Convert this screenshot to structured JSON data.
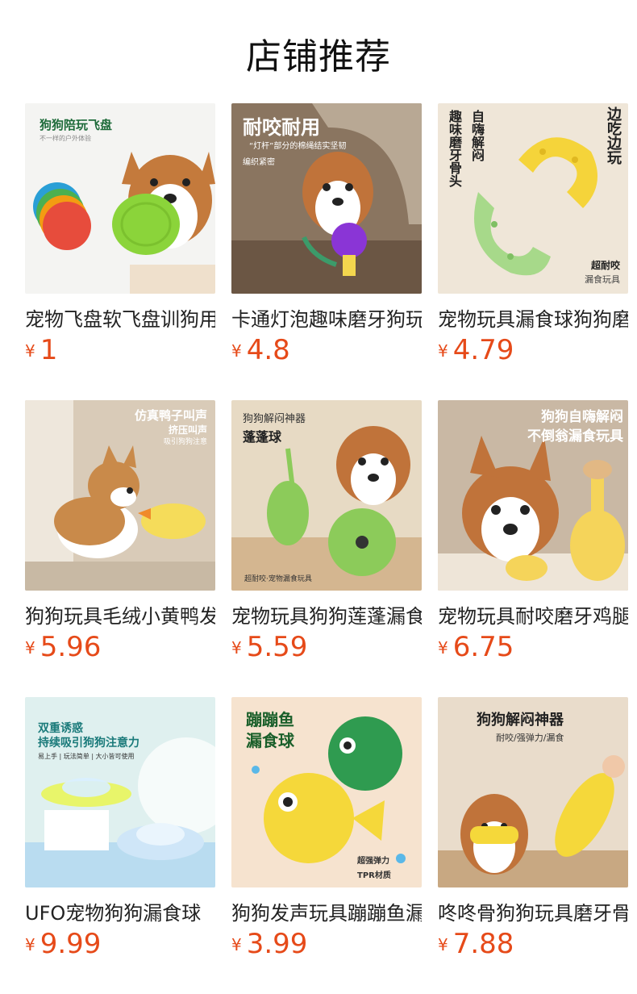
{
  "header": {
    "title": "店铺推荐"
  },
  "products": [
    {
      "name": "宠物飞盘软飞盘训狗用品",
      "currency": "¥",
      "price": "1",
      "image_text": [
        "狗狗陪玩飞盘",
        "不一样的户外体验"
      ],
      "bg": "#f4f4f2"
    },
    {
      "name": "卡通灯泡趣味磨牙狗玩具",
      "currency": "¥",
      "price": "4.8",
      "image_text": [
        "耐咬耐用",
        "“灯杆”部分的棉绳结实坚韧",
        "编织紧密"
      ],
      "bg": "#8a7560"
    },
    {
      "name": "宠物玩具漏食球狗狗磨牙",
      "currency": "¥",
      "price": "4.79",
      "image_text": [
        "趣味磨牙骨头",
        "自嗨解闷",
        "边吃边玩",
        "超耐咬",
        "漏食玩具"
      ],
      "bg": "#efe6d8"
    },
    {
      "name": "狗狗玩具毛绒小黄鸭发声",
      "currency": "¥",
      "price": "5.96",
      "image_text": [
        "仿真鸭子叫声",
        "挤压叫声",
        "吸引狗狗注意"
      ],
      "bg": "#d9cbb8"
    },
    {
      "name": "宠物玩具狗狗莲蓬漏食球",
      "currency": "¥",
      "price": "5.59",
      "image_text": [
        "狗狗解闷神器",
        "蓬蓬球",
        "超耐咬·宠物漏食玩具"
      ],
      "bg": "#e7dac4"
    },
    {
      "name": "宠物玩具耐咬磨牙鸡腿",
      "currency": "¥",
      "price": "6.75",
      "image_text": [
        "狗狗自嗨解闷",
        "不倒翁漏食玩具"
      ],
      "bg": "#c9b8a4"
    },
    {
      "name": "UFO宠物狗狗漏食球",
      "currency": "¥",
      "price": "9.99",
      "image_text": [
        "双重诱惑",
        "持续吸引狗狗注意力",
        "易上手 | 玩法简单 | 大小皆可使用"
      ],
      "bg": "#dff0ef"
    },
    {
      "name": "狗狗发声玩具蹦蹦鱼漏食",
      "currency": "¥",
      "price": "3.99",
      "image_text": [
        "蹦蹦鱼",
        "漏食球",
        "超强弹力",
        "TPR材质"
      ],
      "bg": "#f6e3cf"
    },
    {
      "name": "咚咚骨狗狗玩具磨牙骨头",
      "currency": "¥",
      "price": "7.88",
      "image_text": [
        "狗狗解闷神器",
        "耐咬/强弹力/漏食"
      ],
      "bg": "#e9dccb"
    }
  ],
  "colors": {
    "price": "#e64a19",
    "title": "#111111"
  }
}
